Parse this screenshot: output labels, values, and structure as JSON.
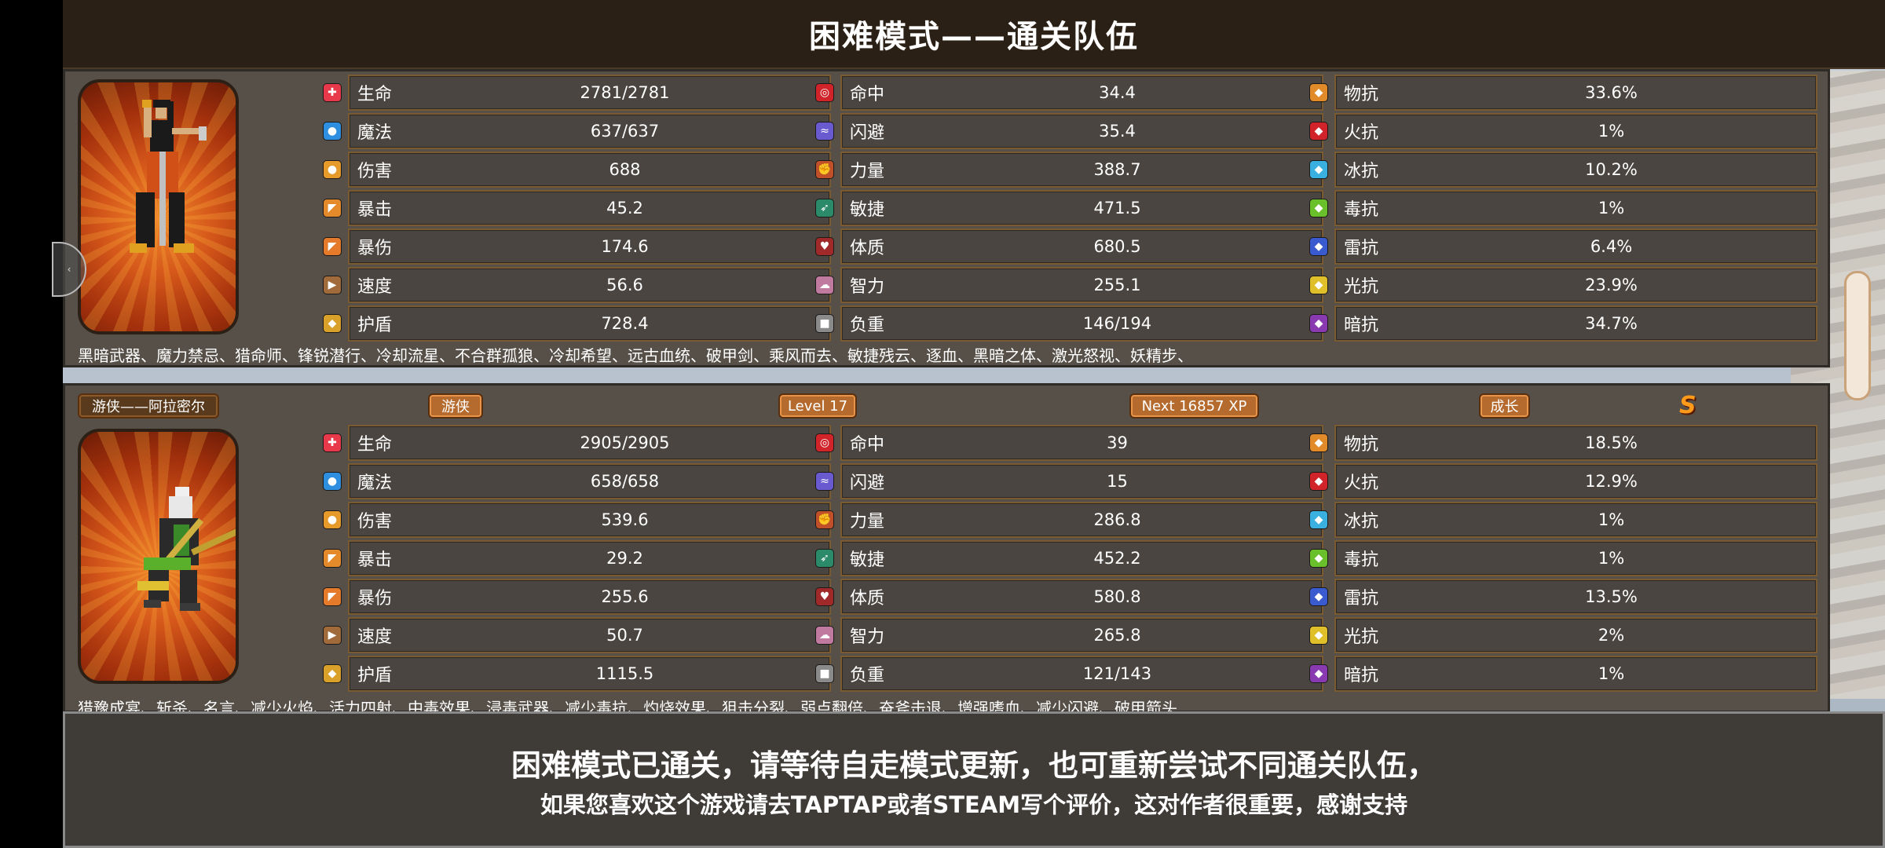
{
  "title": "困难模式——通关队伍",
  "heroes": [
    {
      "skills": "黑暗武器、魔力禁忌、猎命师、锋锐潜行、冷却流星、不合群孤狼、冷却希望、远古血统、破甲剑、乘风而去、敏捷残云、逐血、黑暗之体、激光怒视、妖精步、",
      "col1": [
        {
          "name": "生命",
          "value": "2781/2781",
          "icon": "hp-icon",
          "color": "#e8394a"
        },
        {
          "name": "魔法",
          "value": "637/637",
          "icon": "mp-icon",
          "color": "#2e8fe0"
        },
        {
          "name": "伤害",
          "value": "688",
          "icon": "damage-icon",
          "color": "#e59a2a"
        },
        {
          "name": "暴击",
          "value": "45.2",
          "icon": "crit-icon",
          "color": "#e58a2a"
        },
        {
          "name": "暴伤",
          "value": "174.6",
          "icon": "crit-damage-icon",
          "color": "#e57a2a"
        },
        {
          "name": "速度",
          "value": "56.6",
          "icon": "speed-icon",
          "color": "#a06a3a"
        },
        {
          "name": "护盾",
          "value": "728.4",
          "icon": "shield-icon",
          "color": "#d9a02a"
        }
      ],
      "col2": [
        {
          "name": "命中",
          "value": "34.4",
          "icon": "accuracy-icon",
          "color": "#d0242a"
        },
        {
          "name": "闪避",
          "value": "35.4",
          "icon": "dodge-icon",
          "color": "#6a5ad0"
        },
        {
          "name": "力量",
          "value": "388.7",
          "icon": "strength-icon",
          "color": "#c0502a"
        },
        {
          "name": "敏捷",
          "value": "471.5",
          "icon": "agility-icon",
          "color": "#2a8a6a"
        },
        {
          "name": "体质",
          "value": "680.5",
          "icon": "constitution-icon",
          "color": "#a02a2a"
        },
        {
          "name": "智力",
          "value": "255.1",
          "icon": "intelligence-icon",
          "color": "#c07aa0"
        },
        {
          "name": "负重",
          "value": "146/194",
          "icon": "weight-icon",
          "color": "#8a8a8a"
        }
      ],
      "col3": [
        {
          "name": "物抗",
          "value": "33.6%",
          "icon": "physical-resist-icon",
          "color": "#e08a2a"
        },
        {
          "name": "火抗",
          "value": "1%",
          "icon": "fire-resist-icon",
          "color": "#d0242a"
        },
        {
          "name": "冰抗",
          "value": "10.2%",
          "icon": "ice-resist-icon",
          "color": "#3ab0e0"
        },
        {
          "name": "毒抗",
          "value": "1%",
          "icon": "poison-resist-icon",
          "color": "#6ac02a"
        },
        {
          "name": "雷抗",
          "value": "6.4%",
          "icon": "lightning-resist-icon",
          "color": "#3a5ad0"
        },
        {
          "name": "光抗",
          "value": "23.9%",
          "icon": "light-resist-icon",
          "color": "#e0c02a"
        },
        {
          "name": "暗抗",
          "value": "34.7%",
          "icon": "dark-resist-icon",
          "color": "#8a3ab0"
        }
      ]
    },
    {
      "name_badge": "游侠——阿拉密尔",
      "class_badge": "游侠",
      "level_badge": "Level 17",
      "xp_badge": "Next 16857 XP",
      "growth_badge": "成长",
      "grade": "S",
      "skills": "猎豫成宴、斩杀、名言、减少火焰、活力四射、中毒效果、浸毒武器、减少毒抗、灼烧效果、狙击分裂、弱点翻倍、奋斧击退、增强嗜血、减少闪避、破甲箭头",
      "col1": [
        {
          "name": "生命",
          "value": "2905/2905",
          "icon": "hp-icon",
          "color": "#e8394a"
        },
        {
          "name": "魔法",
          "value": "658/658",
          "icon": "mp-icon",
          "color": "#2e8fe0"
        },
        {
          "name": "伤害",
          "value": "539.6",
          "icon": "damage-icon",
          "color": "#e59a2a"
        },
        {
          "name": "暴击",
          "value": "29.2",
          "icon": "crit-icon",
          "color": "#e58a2a"
        },
        {
          "name": "暴伤",
          "value": "255.6",
          "icon": "crit-damage-icon",
          "color": "#e57a2a"
        },
        {
          "name": "速度",
          "value": "50.7",
          "icon": "speed-icon",
          "color": "#a06a3a"
        },
        {
          "name": "护盾",
          "value": "1115.5",
          "icon": "shield-icon",
          "color": "#d9a02a"
        }
      ],
      "col2": [
        {
          "name": "命中",
          "value": "39",
          "icon": "accuracy-icon",
          "color": "#d0242a"
        },
        {
          "name": "闪避",
          "value": "15",
          "icon": "dodge-icon",
          "color": "#6a5ad0"
        },
        {
          "name": "力量",
          "value": "286.8",
          "icon": "strength-icon",
          "color": "#c0502a"
        },
        {
          "name": "敏捷",
          "value": "452.2",
          "icon": "agility-icon",
          "color": "#2a8a6a"
        },
        {
          "name": "体质",
          "value": "580.8",
          "icon": "constitution-icon",
          "color": "#a02a2a"
        },
        {
          "name": "智力",
          "value": "265.8",
          "icon": "intelligence-icon",
          "color": "#c07aa0"
        },
        {
          "name": "负重",
          "value": "121/143",
          "icon": "weight-icon",
          "color": "#8a8a8a"
        }
      ],
      "col3": [
        {
          "name": "物抗",
          "value": "18.5%",
          "icon": "physical-resist-icon",
          "color": "#e08a2a"
        },
        {
          "name": "火抗",
          "value": "12.9%",
          "icon": "fire-resist-icon",
          "color": "#d0242a"
        },
        {
          "name": "冰抗",
          "value": "1%",
          "icon": "ice-resist-icon",
          "color": "#3ab0e0"
        },
        {
          "name": "毒抗",
          "value": "1%",
          "icon": "poison-resist-icon",
          "color": "#6ac02a"
        },
        {
          "name": "雷抗",
          "value": "13.5%",
          "icon": "lightning-resist-icon",
          "color": "#3a5ad0"
        },
        {
          "name": "光抗",
          "value": "2%",
          "icon": "light-resist-icon",
          "color": "#e0c02a"
        },
        {
          "name": "暗抗",
          "value": "1%",
          "icon": "dark-resist-icon",
          "color": "#8a3ab0"
        }
      ]
    }
  ],
  "footer": {
    "line1": "困难模式已通关，请等待自走模式更新，也可重新尝试不同通关队伍，",
    "line2": "如果您喜欢这个游戏请去TAPTAP或者STEAM写个评价，这对作者很重要，感谢支持"
  }
}
